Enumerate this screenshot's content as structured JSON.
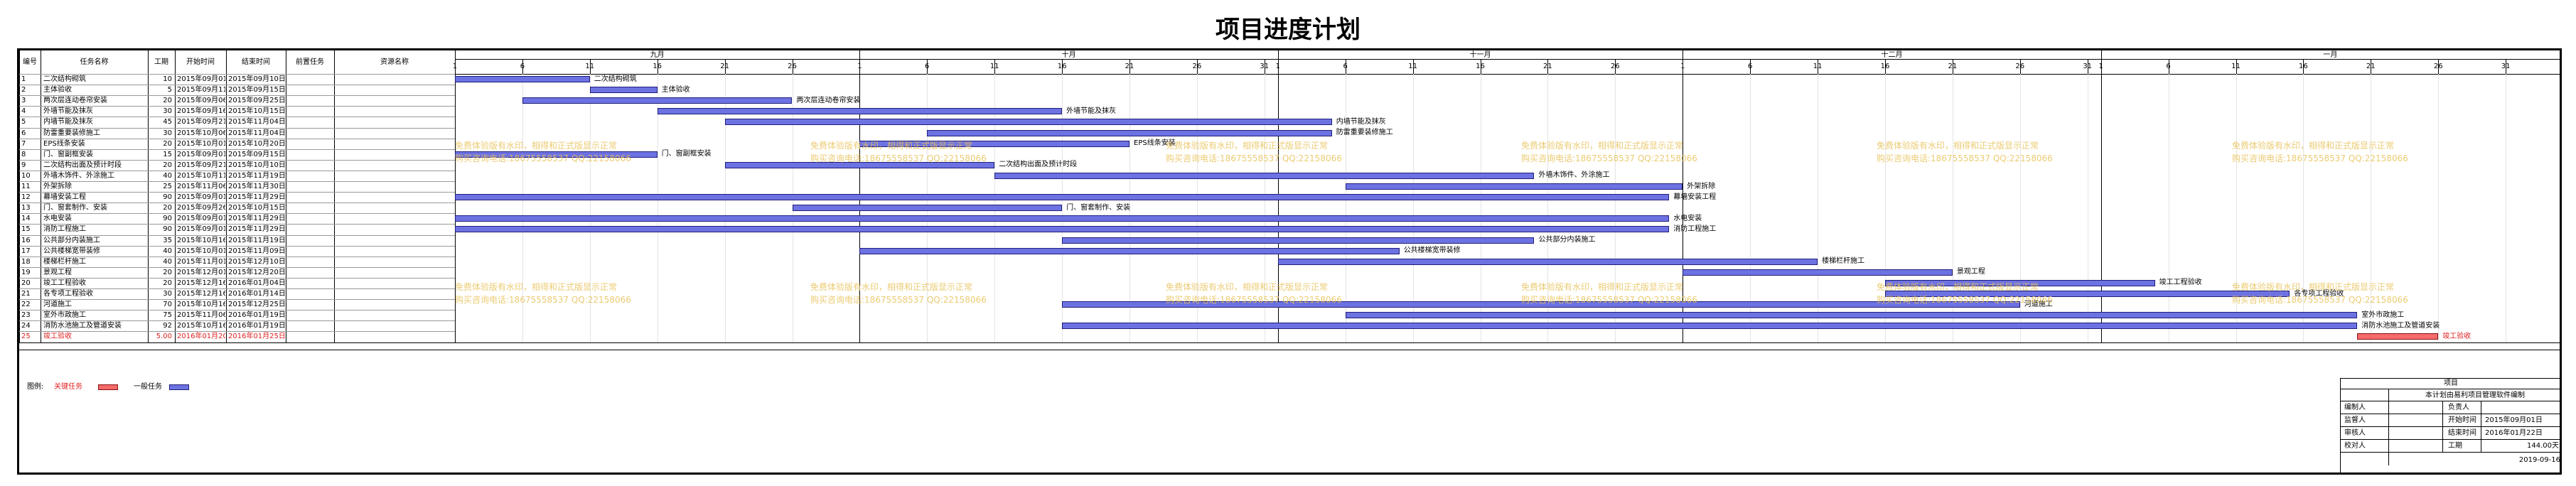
{
  "title": "项目进度计划",
  "columns": [
    "编号",
    "任务名称",
    "工期",
    "开始时间",
    "结束时间",
    "前置任务",
    "资源名称"
  ],
  "timeline": {
    "start": "2015-09-01",
    "end": "2016-02-04",
    "months": [
      {
        "label": "九月",
        "start": "2015-09-01",
        "days": [
          1,
          6,
          11,
          16,
          21,
          26
        ]
      },
      {
        "label": "十月",
        "start": "2015-10-01",
        "days": [
          1,
          6,
          11,
          16,
          21,
          26,
          31
        ]
      },
      {
        "label": "十一月",
        "start": "2015-11-01",
        "days": [
          1,
          6,
          11,
          16,
          21,
          26
        ]
      },
      {
        "label": "十二月",
        "start": "2015-12-01",
        "days": [
          1,
          6,
          11,
          16,
          21,
          26,
          31
        ]
      },
      {
        "label": "一月",
        "start": "2016-01-01",
        "days": [
          1,
          6,
          11,
          16,
          21,
          26,
          31
        ]
      }
    ]
  },
  "chart_data": {
    "type": "gantt",
    "tasks": [
      {
        "id": "1",
        "name": "二次结构砌筑",
        "label": "二次结构砌筑",
        "duration": "10",
        "start": "2015年09月01日",
        "end": "2015年09月10日",
        "s": "2015-09-01",
        "e": "2015-09-10",
        "critical": false
      },
      {
        "id": "2",
        "name": "主体验收",
        "label": "主体验收",
        "duration": "5",
        "start": "2015年09月11日",
        "end": "2015年09月15日",
        "s": "2015-09-11",
        "e": "2015-09-15",
        "critical": false
      },
      {
        "id": "3",
        "name": "两次层连动卷帘安装",
        "label": "两次层连动卷帘安装",
        "duration": "20",
        "start": "2015年09月06日",
        "end": "2015年09月25日",
        "s": "2015-09-06",
        "e": "2015-09-25",
        "critical": false
      },
      {
        "id": "4",
        "name": "外墙节能及抹灰",
        "label": "外墙节能及抹灰",
        "duration": "30",
        "start": "2015年09月16日",
        "end": "2015年10月15日",
        "s": "2015-09-16",
        "e": "2015-10-15",
        "critical": false
      },
      {
        "id": "5",
        "name": "内墙节能及抹灰",
        "label": "内墙节能及抹灰",
        "duration": "45",
        "start": "2015年09月21日",
        "end": "2015年11月04日",
        "s": "2015-09-21",
        "e": "2015-11-04",
        "critical": false
      },
      {
        "id": "6",
        "name": "防雷重要装修施工",
        "label": "防雷重要装修施工",
        "duration": "30",
        "start": "2015年10月06日",
        "end": "2015年11月04日",
        "s": "2015-10-06",
        "e": "2015-11-04",
        "critical": false
      },
      {
        "id": "7",
        "name": "EPS线条安装",
        "label": "EPS线条安装",
        "duration": "20",
        "start": "2015年10月01日",
        "end": "2015年10月20日",
        "s": "2015-10-01",
        "e": "2015-10-20",
        "critical": false
      },
      {
        "id": "8",
        "name": "门、窗副框安装",
        "label": "门、窗副框安装",
        "duration": "15",
        "start": "2015年09月01日",
        "end": "2015年09月15日",
        "s": "2015-09-01",
        "e": "2015-09-15",
        "critical": false
      },
      {
        "id": "9",
        "name": "二次结构出面及预计时段",
        "label": "二次结构出面及预计时段",
        "duration": "20",
        "start": "2015年09月21日",
        "end": "2015年10月10日",
        "s": "2015-09-21",
        "e": "2015-10-10",
        "critical": false
      },
      {
        "id": "10",
        "name": "外墙木饰件、外涂施工",
        "label": "外墙木饰件、外涂施工",
        "duration": "40",
        "start": "2015年10月11日",
        "end": "2015年11月19日",
        "s": "2015-10-11",
        "e": "2015-11-19",
        "critical": false
      },
      {
        "id": "11",
        "name": "外架拆除",
        "label": "外架拆除",
        "duration": "25",
        "start": "2015年11月06日",
        "end": "2015年11月30日",
        "s": "2015-11-06",
        "e": "2015-11-30",
        "critical": false
      },
      {
        "id": "12",
        "name": "幕墙安装工程",
        "label": "幕墙安装工程",
        "duration": "90",
        "start": "2015年09月01日",
        "end": "2015年11月29日",
        "s": "2015-09-01",
        "e": "2015-11-29",
        "critical": false
      },
      {
        "id": "13",
        "name": "门、窗套制作、安装",
        "label": "门、窗套制作、安装",
        "duration": "20",
        "start": "2015年09月26日",
        "end": "2015年10月15日",
        "s": "2015-09-26",
        "e": "2015-10-15",
        "critical": false
      },
      {
        "id": "14",
        "name": "水电安装",
        "label": "水电安装",
        "duration": "90",
        "start": "2015年09月01日",
        "end": "2015年11月29日",
        "s": "2015-09-01",
        "e": "2015-11-29",
        "critical": false
      },
      {
        "id": "15",
        "name": "消防工程施工",
        "label": "消防工程施工",
        "duration": "90",
        "start": "2015年09月01日",
        "end": "2015年11月29日",
        "s": "2015-09-01",
        "e": "2015-11-29",
        "critical": false
      },
      {
        "id": "16",
        "name": "公共部分内装施工",
        "label": "公共部分内装施工",
        "duration": "35",
        "start": "2015年10月16日",
        "end": "2015年11月19日",
        "s": "2015-10-16",
        "e": "2015-11-19",
        "critical": false
      },
      {
        "id": "17",
        "name": "公共楼梯宽带装修",
        "label": "公共楼梯宽带装修",
        "duration": "40",
        "start": "2015年10月01日",
        "end": "2015年11月09日",
        "s": "2015-10-01",
        "e": "2015-11-09",
        "critical": false
      },
      {
        "id": "18",
        "name": "楼梯栏杆施工",
        "label": "楼梯栏杆施工",
        "duration": "40",
        "start": "2015年11月01日",
        "end": "2015年12月10日",
        "s": "2015-11-01",
        "e": "2015-12-10",
        "critical": false
      },
      {
        "id": "19",
        "name": "景观工程",
        "label": "景观工程",
        "duration": "20",
        "start": "2015年12月01日",
        "end": "2015年12月20日",
        "s": "2015-12-01",
        "e": "2015-12-20",
        "critical": false
      },
      {
        "id": "20",
        "name": "竣工工程验收",
        "label": "竣工工程验收",
        "duration": "20",
        "start": "2015年12月16日",
        "end": "2016年01月04日",
        "s": "2015-12-16",
        "e": "2016-01-04",
        "critical": false
      },
      {
        "id": "21",
        "name": "各专项工程验收",
        "label": "各专项工程验收",
        "duration": "30",
        "start": "2015年12月16日",
        "end": "2016年01月14日",
        "s": "2015-12-16",
        "e": "2016-01-14",
        "critical": false
      },
      {
        "id": "22",
        "name": "河道施工",
        "label": "河道施工",
        "duration": "70",
        "start": "2015年10月16日",
        "end": "2015年12月25日",
        "s": "2015-10-16",
        "e": "2015-12-25",
        "critical": false
      },
      {
        "id": "23",
        "name": "室外市政施工",
        "label": "室外市政施工",
        "duration": "75",
        "start": "2015年11月06日",
        "end": "2016年01月19日",
        "s": "2015-11-06",
        "e": "2016-01-19",
        "critical": false
      },
      {
        "id": "24",
        "name": "消防水池施工及管道安装",
        "label": "消防水池施工及管道安装",
        "duration": "92",
        "start": "2015年10月16日",
        "end": "2016年01月19日",
        "s": "2015-10-16",
        "e": "2016-01-19",
        "critical": false
      },
      {
        "id": "25",
        "name": "竣工验收",
        "label": "竣工验收",
        "duration": "5.00",
        "start": "2016年01月20日",
        "end": "2016年01月25日",
        "s": "2016-01-20",
        "e": "2016-01-25",
        "critical": true
      }
    ],
    "legend": [
      {
        "label": "关键任务",
        "color": "#f56a6a"
      },
      {
        "label": "一般任务",
        "color": "#6d72e2"
      }
    ]
  },
  "legend_label": "图例:",
  "watermark": {
    "line1": "免费体验版有水印，相得和正式版显示正常",
    "line2": "购买咨询电话:18675558537 QQ:22158066"
  },
  "info_block": {
    "header": "项目",
    "project": "本计划由易利项目管理软件编制",
    "rows": [
      {
        "k1": "编制人",
        "v1": "",
        "k2": "负责人",
        "v2": ""
      },
      {
        "k1": "监督人",
        "v1": "",
        "k2": "开始时间",
        "v2": "2015年09月01日"
      },
      {
        "k1": "审核人",
        "v1": "",
        "k2": "结束时间",
        "v2": "2016年01月22日"
      },
      {
        "k1": "校对人",
        "v1": "",
        "k2": "工期",
        "v2": "144.00天"
      }
    ],
    "date": "2019-09-16"
  }
}
